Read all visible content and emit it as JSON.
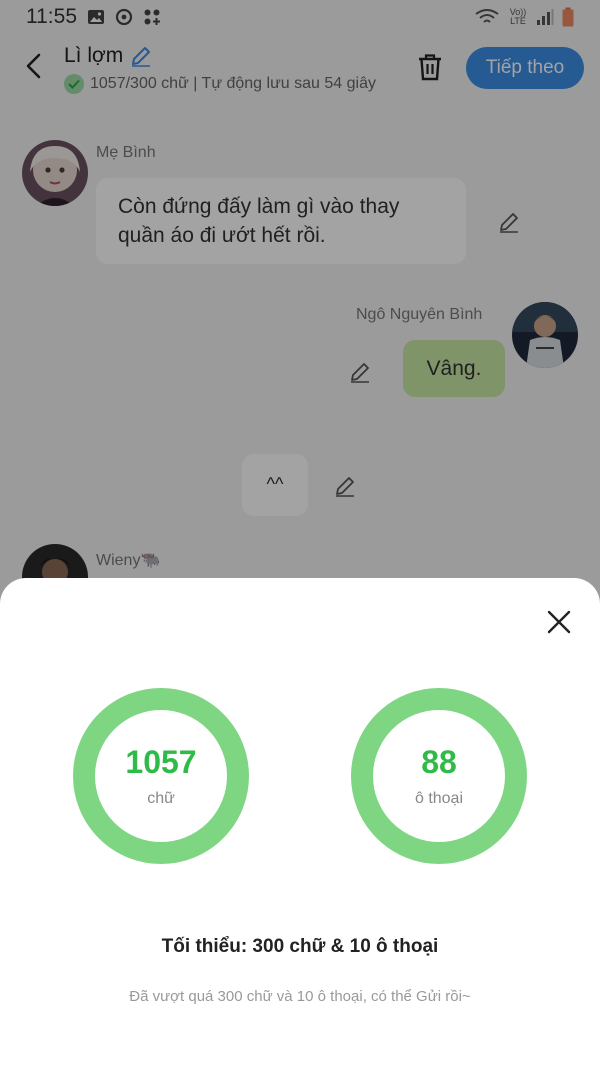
{
  "status_bar": {
    "time": "11:55",
    "network": "Vo)) LTE"
  },
  "header": {
    "title": "Lì lợm",
    "subtitle": "1057/300 chữ | Tự động lưu sau 54 giây",
    "next_label": "Tiếp theo"
  },
  "chat": {
    "messages": [
      {
        "sender": "Mẹ Bình",
        "text": "Còn đứng đấy làm gì vào thay quần áo đi ướt hết rồi."
      },
      {
        "sender": "Ngô Nguyên Bình",
        "text": "Vâng."
      },
      {
        "sender": "",
        "text": "^^"
      },
      {
        "sender": "Wieny🐃",
        "text": ""
      }
    ]
  },
  "sheet": {
    "stats": [
      {
        "value": "1057",
        "label": "chữ"
      },
      {
        "value": "88",
        "label": "ô thoại"
      }
    ],
    "minimum": "Tối thiểu: 300 chữ & 10 ô thoại",
    "note": "Đã vượt quá 300 chữ và 10 ô thoại, có thể Gửi rồi~"
  },
  "colors": {
    "accent": "#3a8ee6",
    "ring": "#7ed682",
    "value_green": "#2fbb47",
    "bubble_green": "#c8e8a6"
  }
}
